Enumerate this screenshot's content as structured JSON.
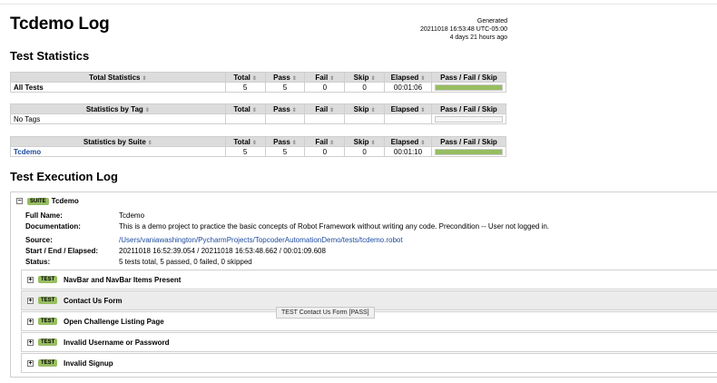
{
  "title": "Tcdemo Log",
  "generated": {
    "label": "Generated",
    "timestamp": "20211018 16:53:48 UTC-05:00",
    "ago": "4 days 21 hours ago"
  },
  "test_statistics": {
    "heading": "Test Statistics",
    "columns": [
      "Total",
      "Pass",
      "Fail",
      "Skip",
      "Elapsed",
      "Pass / Fail / Skip"
    ],
    "tables": [
      {
        "header": "Total Statistics",
        "rows": [
          {
            "name": "All Tests",
            "total": "5",
            "pass": "5",
            "fail": "0",
            "skip": "0",
            "elapsed": "00:01:06",
            "pass_fraction": 1.0
          }
        ]
      },
      {
        "header": "Statistics by Tag",
        "rows": [
          {
            "name": "No Tags",
            "total": "",
            "pass": "",
            "fail": "",
            "skip": "",
            "elapsed": "",
            "pass_fraction": 0
          }
        ]
      },
      {
        "header": "Statistics by Suite",
        "rows": [
          {
            "name": "Tcdemo",
            "total": "5",
            "pass": "5",
            "fail": "0",
            "skip": "0",
            "elapsed": "00:01:10",
            "pass_fraction": 1.0
          }
        ]
      }
    ]
  },
  "execution_log": {
    "heading": "Test Execution Log",
    "suite": {
      "label": "SUITE",
      "name": "Tcdemo",
      "collapse_glyph": "−",
      "fields": [
        {
          "key": "Full Name:",
          "value": "Tcdemo"
        },
        {
          "key": "Documentation:",
          "value": "This is a demo project to practice the basic concepts of Robot Framework without writing any code. Precondition -- User not logged in."
        },
        {
          "key": "Source:",
          "value": "/Users/vaniawashington/PycharmProjects/TopcoderAutomationDemo/tests/tcdemo.robot"
        },
        {
          "key": "Start / End / Elapsed:",
          "value": "20211018 16:52:39.054 / 20211018 16:53:48.662 / 00:01:09.608"
        },
        {
          "key": "Status:",
          "value": "5 tests total, 5 passed, 0 failed, 0 skipped"
        }
      ]
    },
    "tests": [
      {
        "label": "TEST",
        "name": "NavBar and NavBar Items Present",
        "expand_glyph": "+"
      },
      {
        "label": "TEST",
        "name": "Contact Us Form",
        "expand_glyph": "+"
      },
      {
        "label": "TEST",
        "name": "Open Challenge Listing Page",
        "expand_glyph": "+"
      },
      {
        "label": "TEST",
        "name": "Invalid Username or Password",
        "expand_glyph": "+"
      },
      {
        "label": "TEST",
        "name": "Invalid Signup",
        "expand_glyph": "+"
      }
    ],
    "tooltip": "TEST  Contact Us Form  [PASS]"
  },
  "colors": {
    "pass": "#97bd61",
    "link": "#1c4a9e",
    "header_bg": "#dcdcdc"
  },
  "icons": {
    "sort": "sort-arrows-icon"
  }
}
